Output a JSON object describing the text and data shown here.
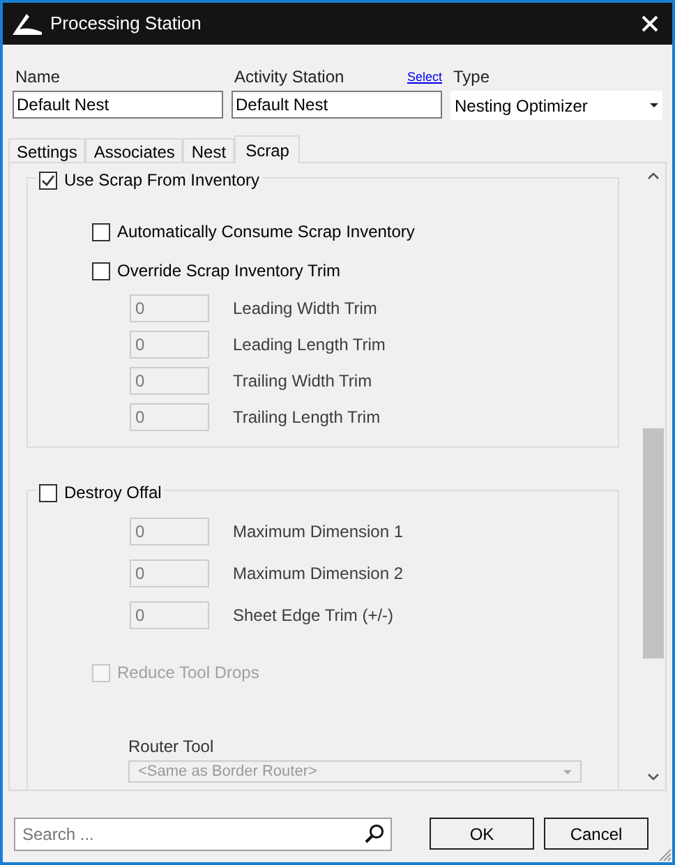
{
  "window": {
    "title": "Processing Station"
  },
  "fields": {
    "name": {
      "label": "Name",
      "value": "Default Nest"
    },
    "activity_station": {
      "label": "Activity Station",
      "link": "Select",
      "value": "Default Nest"
    },
    "type": {
      "label": "Type",
      "value": "Nesting Optimizer"
    }
  },
  "tabs": [
    {
      "label": "Settings",
      "selected": false
    },
    {
      "label": "Associates",
      "selected": false
    },
    {
      "label": "Nest",
      "selected": false
    },
    {
      "label": "Scrap",
      "selected": true
    }
  ],
  "groups": [
    {
      "label": "Use Scrap From Inventory",
      "checked": true,
      "items": [
        {
          "kind": "checkbox",
          "label": "Automatically Consume Scrap Inventory",
          "checked": false,
          "disabled": false
        },
        {
          "kind": "checkbox",
          "label": "Override Scrap Inventory Trim",
          "checked": false,
          "disabled": false,
          "children": [
            {
              "kind": "number",
              "value": "0",
              "label": "Leading Width Trim",
              "disabled": true
            },
            {
              "kind": "number",
              "value": "0",
              "label": "Leading Length Trim",
              "disabled": true
            },
            {
              "kind": "number",
              "value": "0",
              "label": "Trailing Width Trim",
              "disabled": true
            },
            {
              "kind": "number",
              "value": "0",
              "label": "Trailing Length Trim",
              "disabled": true
            }
          ]
        }
      ]
    },
    {
      "label": "Destroy Offal",
      "checked": false,
      "items": [
        {
          "kind": "number",
          "value": "0",
          "label": "Maximum Dimension 1",
          "disabled": true
        },
        {
          "kind": "number",
          "value": "0",
          "label": "Maximum Dimension 2",
          "disabled": true
        },
        {
          "kind": "number",
          "value": "0",
          "label": "Sheet Edge Trim (+/-)",
          "disabled": true
        },
        {
          "kind": "checkbox",
          "label": "Reduce Tool Drops",
          "checked": false,
          "disabled": true
        },
        {
          "kind": "select",
          "label": "Router Tool",
          "value": "<Same as Border Router>",
          "disabled": true
        }
      ]
    }
  ],
  "search": {
    "placeholder": "Search ..."
  },
  "buttons": [
    "OK",
    "Cancel"
  ]
}
